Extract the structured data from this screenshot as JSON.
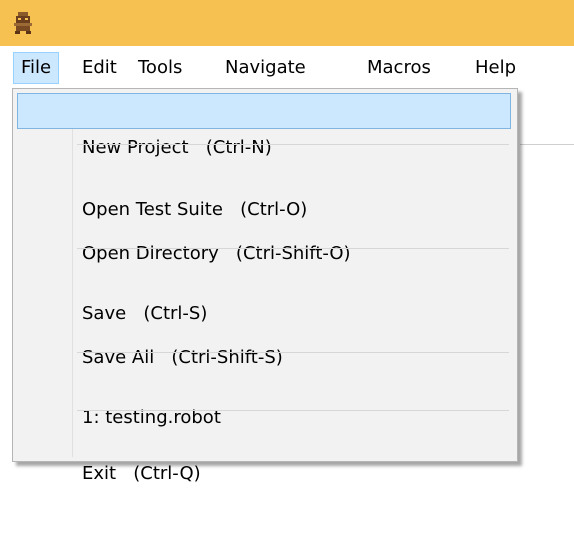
{
  "titlebar": {
    "background_color": "#f7c152",
    "icon": "robot-app-icon"
  },
  "menubar": {
    "items": [
      {
        "label": "File",
        "active": true
      },
      {
        "label": "Edit"
      },
      {
        "label": "Tools"
      },
      {
        "label": "Navigate"
      },
      {
        "label": "Macros"
      },
      {
        "label": "Help"
      }
    ]
  },
  "file_menu": {
    "items": [
      {
        "label": "New Project   (Ctrl-N)",
        "highlighted": true
      },
      {
        "label": "Open Test Suite   (Ctrl-O)"
      },
      {
        "label": "Open Directory   (Ctrl-Shift-O)"
      },
      {
        "label": "Save   (Ctrl-S)"
      },
      {
        "label": "Save All   (Ctrl-Shift-S)"
      },
      {
        "label": "1: testing.robot"
      },
      {
        "label": "Exit   (Ctrl-Q)"
      }
    ]
  },
  "colors": {
    "highlight_bg": "#cce8ff",
    "highlight_border": "#99d1ff",
    "menu_bg": "#f2f2f2"
  }
}
